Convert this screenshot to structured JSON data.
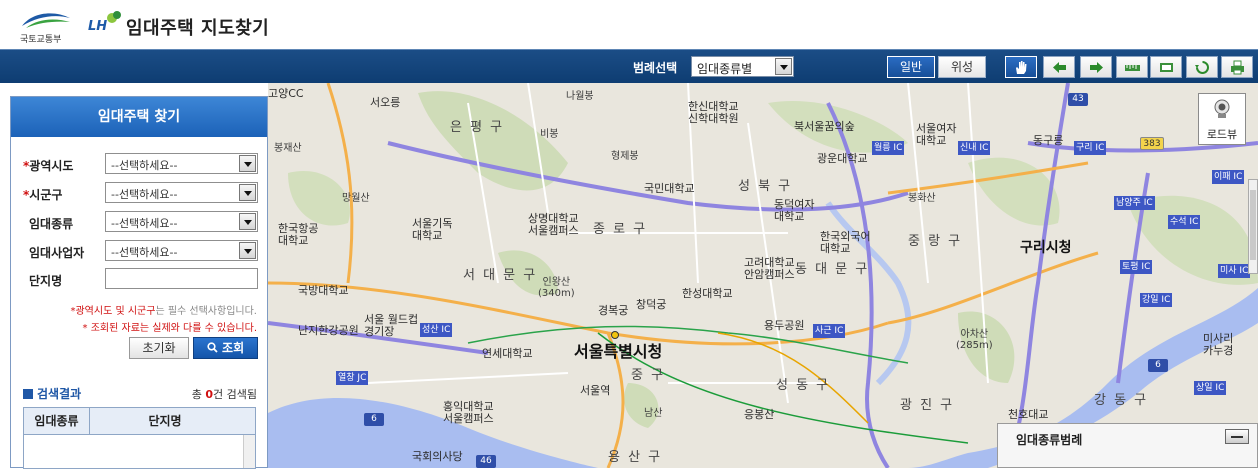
{
  "header": {
    "ministry_caption": "국토교통부",
    "lh_logo_text": "LH",
    "site_title": "임대주택 지도찾기"
  },
  "toolbar": {
    "legend_label": "범례선택",
    "legend_select_value": "임대종류별",
    "mode_general": "일반",
    "mode_satellite": "위성",
    "tools": [
      "hand-pan-icon",
      "arrow-left-icon",
      "arrow-right-icon",
      "ruler-icon",
      "area-measure-icon",
      "refresh-icon",
      "print-icon"
    ]
  },
  "side_panel": {
    "title": "임대주택 찾기",
    "fields": [
      {
        "label": "광역시도",
        "required": "*",
        "value": "--선택하세요--"
      },
      {
        "label": "시군구",
        "required": "*",
        "value": "--선택하세요--"
      },
      {
        "label": "임대종류",
        "required": "",
        "value": "--선택하세요--"
      },
      {
        "label": "임대사업자",
        "required": "",
        "value": "--선택하세요--"
      },
      {
        "label": "단지명",
        "required": "",
        "value": ""
      }
    ],
    "note1_prefix": "*",
    "note1_red": "광역시도 및 시군구",
    "note1_gray": "는 필수 선택사항입니다.",
    "note2": "* 조회된 자료는 실제와 다를 수 있습니다.",
    "reset_label": "초기화",
    "search_label": "조회",
    "results_title": "검색결과",
    "results_count_prefix": "총",
    "results_count": "0",
    "results_count_suffix": "건 검색됨",
    "table_headers": [
      "임대종류",
      "단지명"
    ]
  },
  "map": {
    "roadview_label": "로드뷰",
    "legend_panel_title": "임대종류범례",
    "labels": {
      "eunpyeong": "은 평 구",
      "seongbuk": "성 북 구",
      "jongno": "종 로 구",
      "seodaemun": "서 대 문 구",
      "dongdaemun": "동 대 문 구",
      "jungnang": "중 랑 구",
      "junggu": "중 구",
      "seongdong": "성 동 구",
      "gwangjin": "광 진 구",
      "gangdong": "강 동 구",
      "yongsan": "용 산 구",
      "cityhall": "서울특별시청",
      "guri": "구리시청",
      "goyang": "고양CC",
      "seooreung": "서오릉",
      "bongjesan": "봉재산",
      "nabulbong": "나월봉",
      "bibong": "비봉",
      "hyeonjebong": "형제봉",
      "hansin": "한신대학교\n신학대학원",
      "bugaksan": "북서울꿈의숲",
      "seoulwomen": "서울여자\n대학교",
      "donggureung": "동구릉",
      "mangwolsan": "망월산",
      "kookmin": "국민대학교",
      "kwangwoon": "광운대학교",
      "dongduk": "동덕여자\n대학교",
      "bonghwasan": "봉화산",
      "sangmyung": "상명대학교\n서울캠퍼스",
      "hangongdae": "한국항공\n대학교",
      "seoulgido": "서울기독\n대학교",
      "hufs": "한국외국어\n대학교",
      "korea": "고려대학교\n안암캠퍼스",
      "inwangsan": "인왕산\n(340m)",
      "gyeongbok": "경복궁",
      "changdeok": "창덕궁",
      "hansung": "한성대학교",
      "kukbang": "국방대학교",
      "worldcup": "서울 월드컵\n경기장",
      "nanji": "난지한강공원",
      "yonsei": "연세대학교",
      "hongik": "홍익대학교\n서울캠퍼스",
      "seoulstation": "서울역",
      "namsan": "남산",
      "eungbong": "응봉산",
      "yongdap": "용두공원",
      "achasan": "아차산\n(285m)",
      "assembly": "국회의사당",
      "misa": "미사리\n카누경",
      "cheonho": "천호대교"
    },
    "ics": [
      "월릉 IC",
      "신내 IC",
      "구리 IC",
      "이패 IC",
      "남양주 IC",
      "토평 IC",
      "미사 IC",
      "강일 IC",
      "상일 IC",
      "수석 IC",
      "성산 IC",
      "사근 IC",
      "열창 JC"
    ],
    "shields": [
      "43",
      "383",
      "6",
      "6",
      "46"
    ]
  }
}
